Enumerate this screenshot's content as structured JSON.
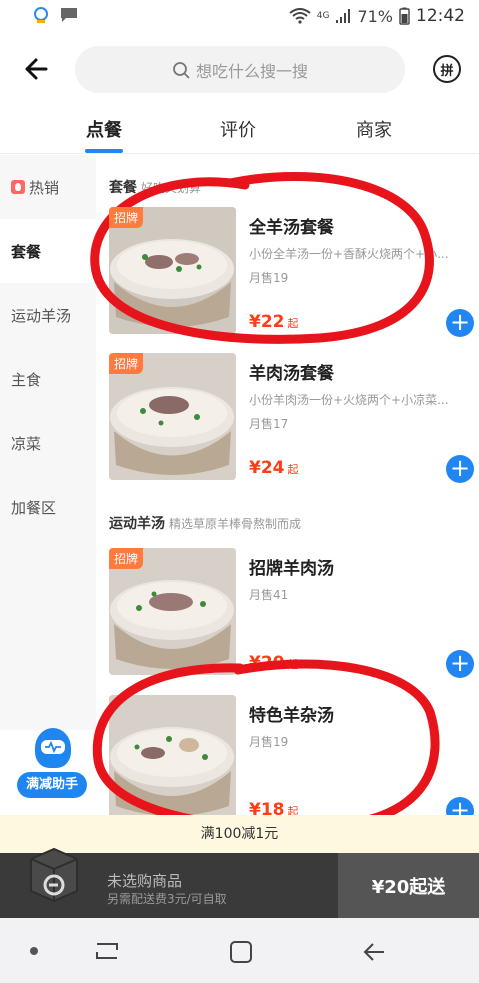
{
  "status_bar": {
    "signal_label": "4G",
    "battery": "71%",
    "time": "12:42"
  },
  "header": {
    "search_placeholder": "想吃什么搜一搜",
    "pin_label": "拼"
  },
  "tabs": [
    {
      "label": "点餐",
      "active": true
    },
    {
      "label": "评价",
      "active": false
    },
    {
      "label": "商家",
      "active": false
    }
  ],
  "sidebar": {
    "items": [
      {
        "label": "热销",
        "active": false,
        "icon": "fire-icon"
      },
      {
        "label": "套餐",
        "active": true
      },
      {
        "label": "运动羊汤",
        "active": false
      },
      {
        "label": "主食",
        "active": false
      },
      {
        "label": "凉菜",
        "active": false
      },
      {
        "label": "加餐区",
        "active": false
      }
    ]
  },
  "sections": [
    {
      "title": "套餐",
      "subtitle": "好吃又划算",
      "items": [
        {
          "badge": "招牌",
          "name": "全羊汤套餐",
          "desc": "小份全羊汤一份+香酥火烧两个+小...",
          "sold": "月售19",
          "price": "¥22",
          "price_suffix": "起"
        },
        {
          "badge": "招牌",
          "name": "羊肉汤套餐",
          "desc": "小份羊肉汤一份+火烧两个+小凉菜...",
          "sold": "月售17",
          "price": "¥24",
          "price_suffix": "起"
        }
      ]
    },
    {
      "title": "运动羊汤",
      "subtitle": "精选草原羊棒骨熬制而成",
      "items": [
        {
          "badge": "招牌",
          "name": "招牌羊肉汤",
          "desc": "",
          "sold": "月售41",
          "price": "¥20",
          "price_suffix": "起"
        },
        {
          "badge": "",
          "name": "特色羊杂汤",
          "desc": "",
          "sold": "月售19",
          "price": "¥18",
          "price_suffix": "起"
        }
      ]
    }
  ],
  "helper": {
    "label": "满减助手"
  },
  "promo": {
    "text": "满100减1元"
  },
  "cart": {
    "title": "未选购商品",
    "sub": "另需配送费3元/可自取",
    "min_order": "¥20起送"
  },
  "colors": {
    "accent": "#2186f2",
    "price": "#ff3c15",
    "badge": "#ff7a3c",
    "annotation": "#e8141b"
  }
}
